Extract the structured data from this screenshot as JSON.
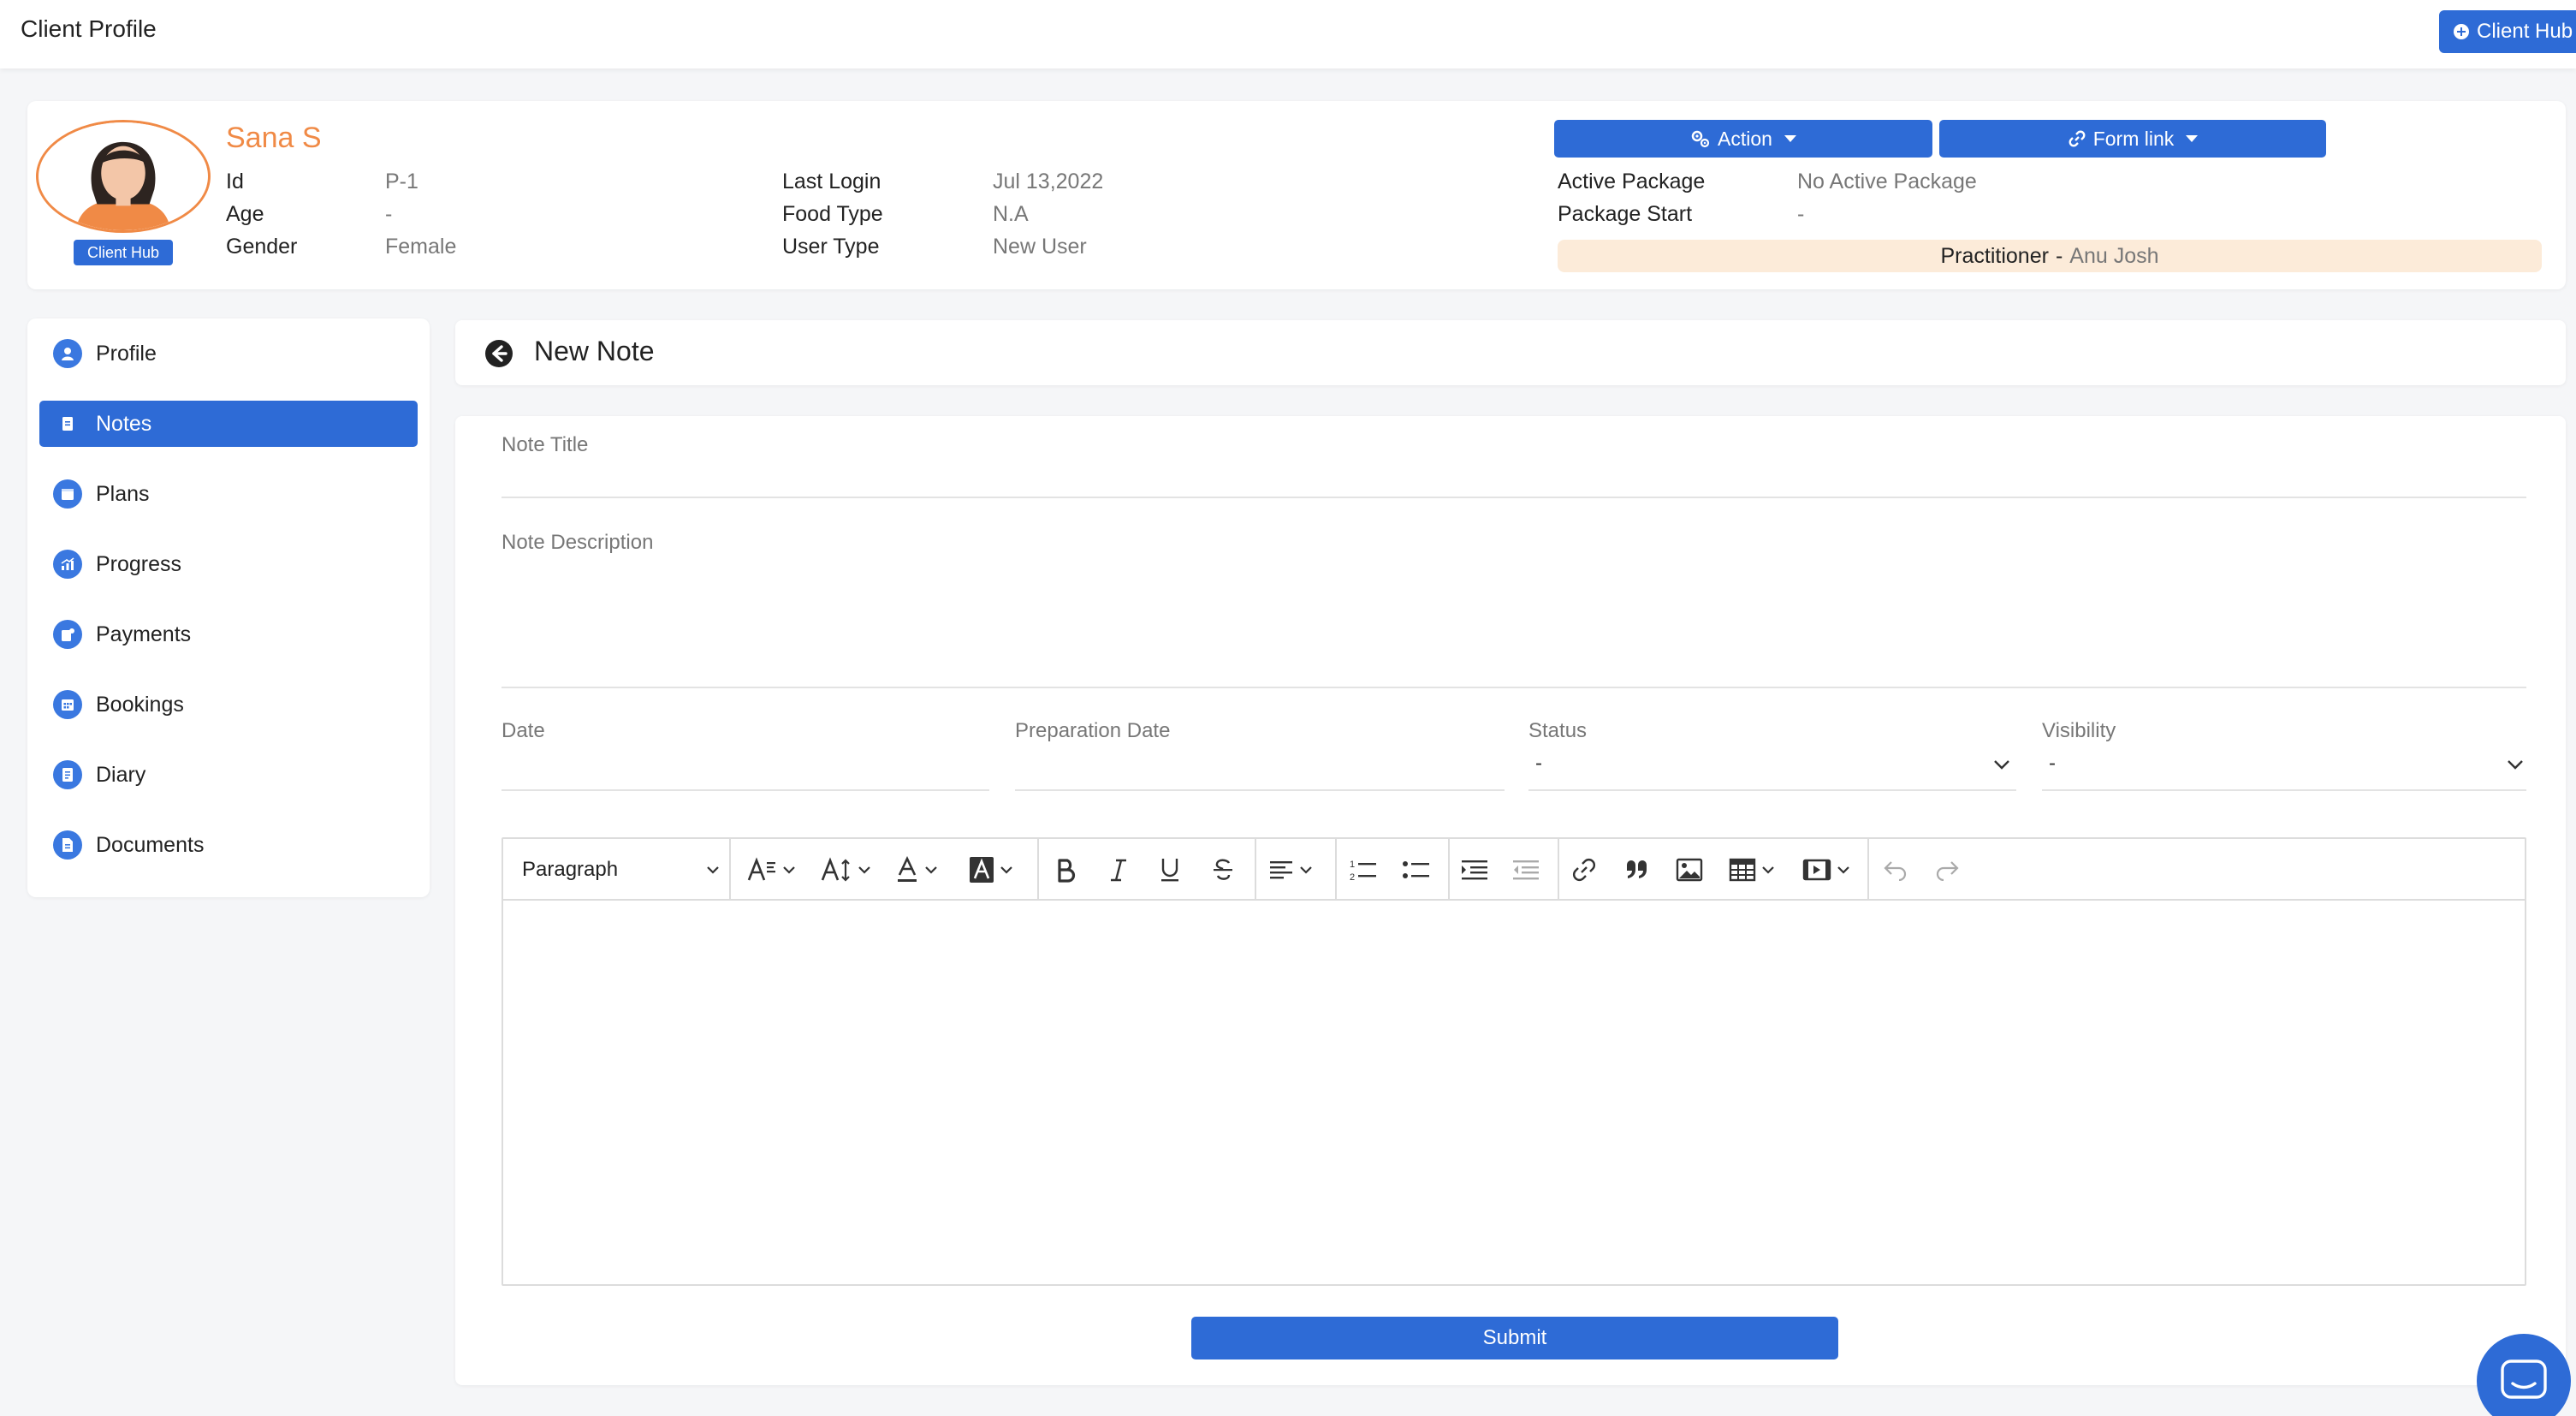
{
  "header": {
    "title": "Client Profile",
    "client_hub_button": "Client Hub"
  },
  "client": {
    "name": "Sana S",
    "badge": "Client Hub",
    "details_left": [
      {
        "label": "Id",
        "value": "P-1"
      },
      {
        "label": "Age",
        "value": "-"
      },
      {
        "label": "Gender",
        "value": "Female"
      }
    ],
    "details_middle": [
      {
        "label": "Last Login",
        "value": "Jul 13,2022"
      },
      {
        "label": "Food Type",
        "value": "N.A"
      },
      {
        "label": "User Type",
        "value": "New User"
      }
    ],
    "details_right": [
      {
        "label": "Active Package",
        "value": "No Active Package"
      },
      {
        "label": "Package Start",
        "value": "-"
      }
    ],
    "action_button": "Action",
    "form_link_button": "Form link",
    "practitioner_label": "Practitioner",
    "practitioner_sep": "-",
    "practitioner_name": "Anu Josh"
  },
  "sidebar": {
    "items": [
      {
        "label": "Profile",
        "icon": "profile-icon",
        "active": false
      },
      {
        "label": "Notes",
        "icon": "notes-icon",
        "active": true
      },
      {
        "label": "Plans",
        "icon": "plans-icon",
        "active": false
      },
      {
        "label": "Progress",
        "icon": "progress-icon",
        "active": false
      },
      {
        "label": "Payments",
        "icon": "payments-icon",
        "active": false
      },
      {
        "label": "Bookings",
        "icon": "bookings-icon",
        "active": false
      },
      {
        "label": "Diary",
        "icon": "diary-icon",
        "active": false
      },
      {
        "label": "Documents",
        "icon": "documents-icon",
        "active": false
      }
    ]
  },
  "note": {
    "header_title": "New Note",
    "title_label": "Note Title",
    "description_label": "Note Description",
    "date_label": "Date",
    "preparation_date_label": "Preparation Date",
    "status_label": "Status",
    "status_value": "-",
    "visibility_label": "Visibility",
    "visibility_value": "-",
    "editor": {
      "paragraph_select": "Paragraph"
    },
    "submit_button": "Submit"
  },
  "colors": {
    "primary": "#2e6bd6",
    "accent": "#f08a46",
    "practitioner_bg": "#fcebd9"
  }
}
